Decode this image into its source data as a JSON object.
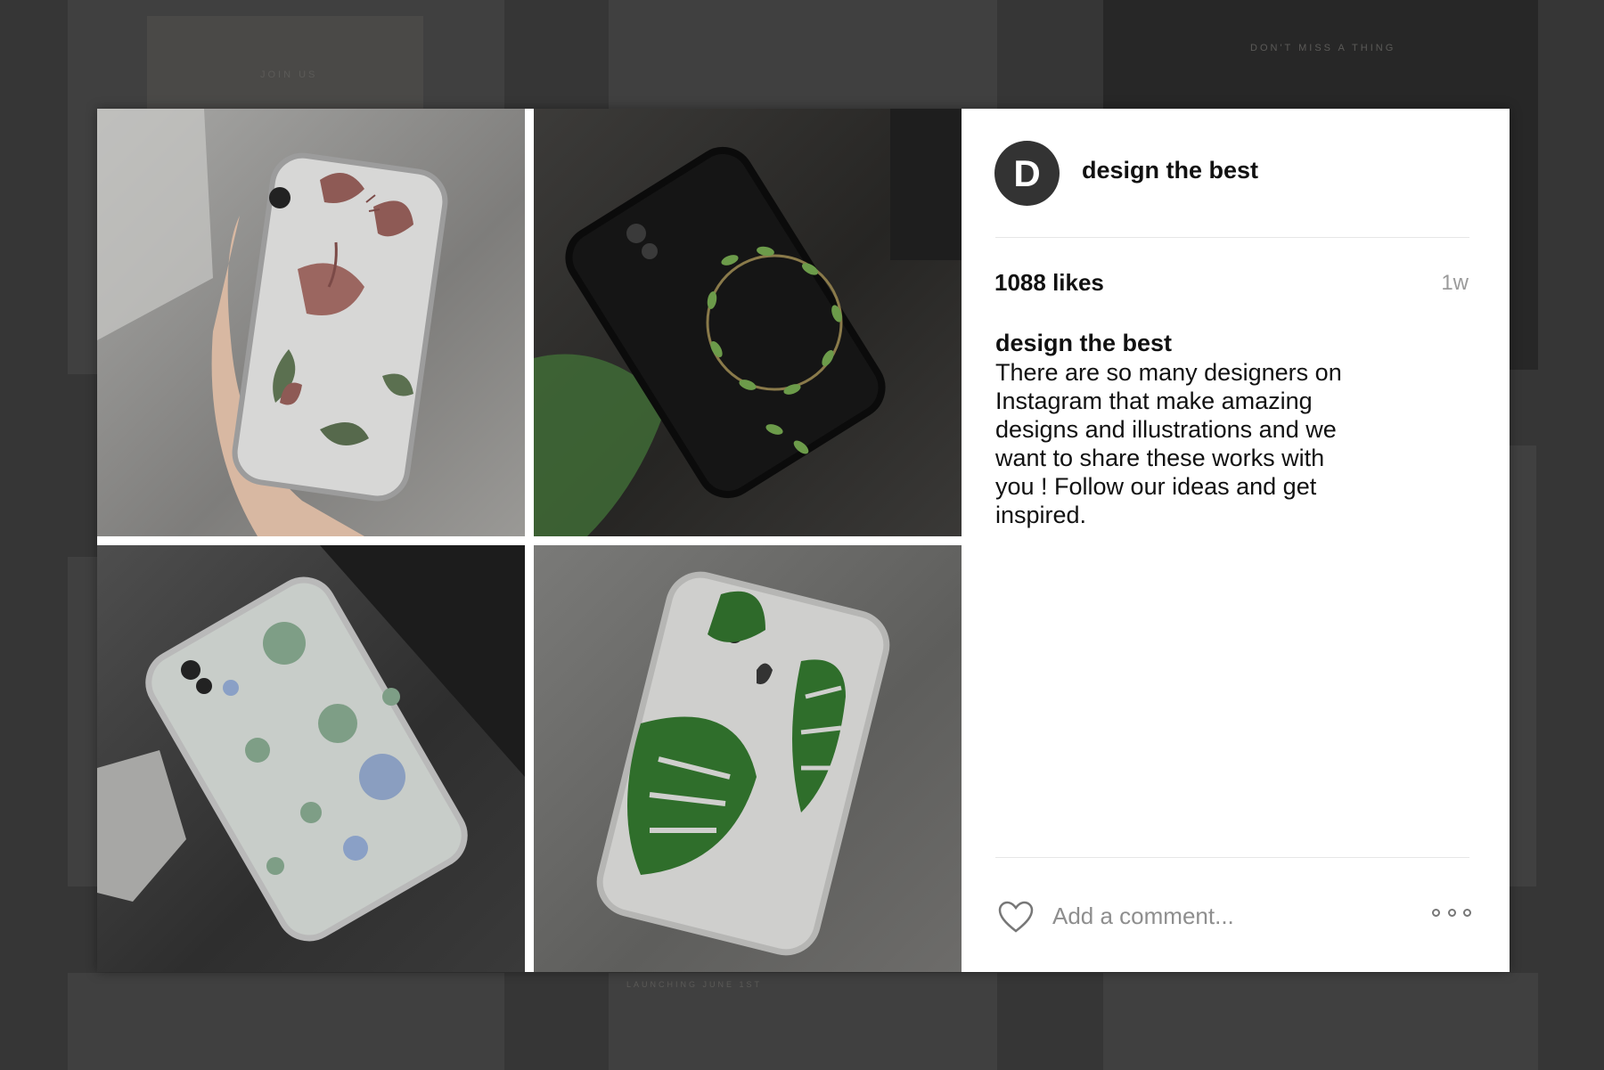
{
  "background": {
    "labels": [
      "JOIN US",
      "DON'T MISS A THING",
      "LAUNCHING JUNE 1ST"
    ]
  },
  "post": {
    "avatar_letter": "D",
    "username": "design the best",
    "likes": "1088 likes",
    "time": "1w",
    "caption_user": "design the best",
    "caption_text": "There are so many designers on Instagram that make amazing designs and illustrations and we want to share these works with you ! Follow our ideas and get inspired."
  },
  "comment": {
    "placeholder": "Add a comment..."
  },
  "icons": {
    "like": "heart-icon",
    "more": "more-options-icon"
  },
  "colors": {
    "avatar_bg": "#333333",
    "text": "#111111",
    "muted": "#9a9a9a"
  }
}
